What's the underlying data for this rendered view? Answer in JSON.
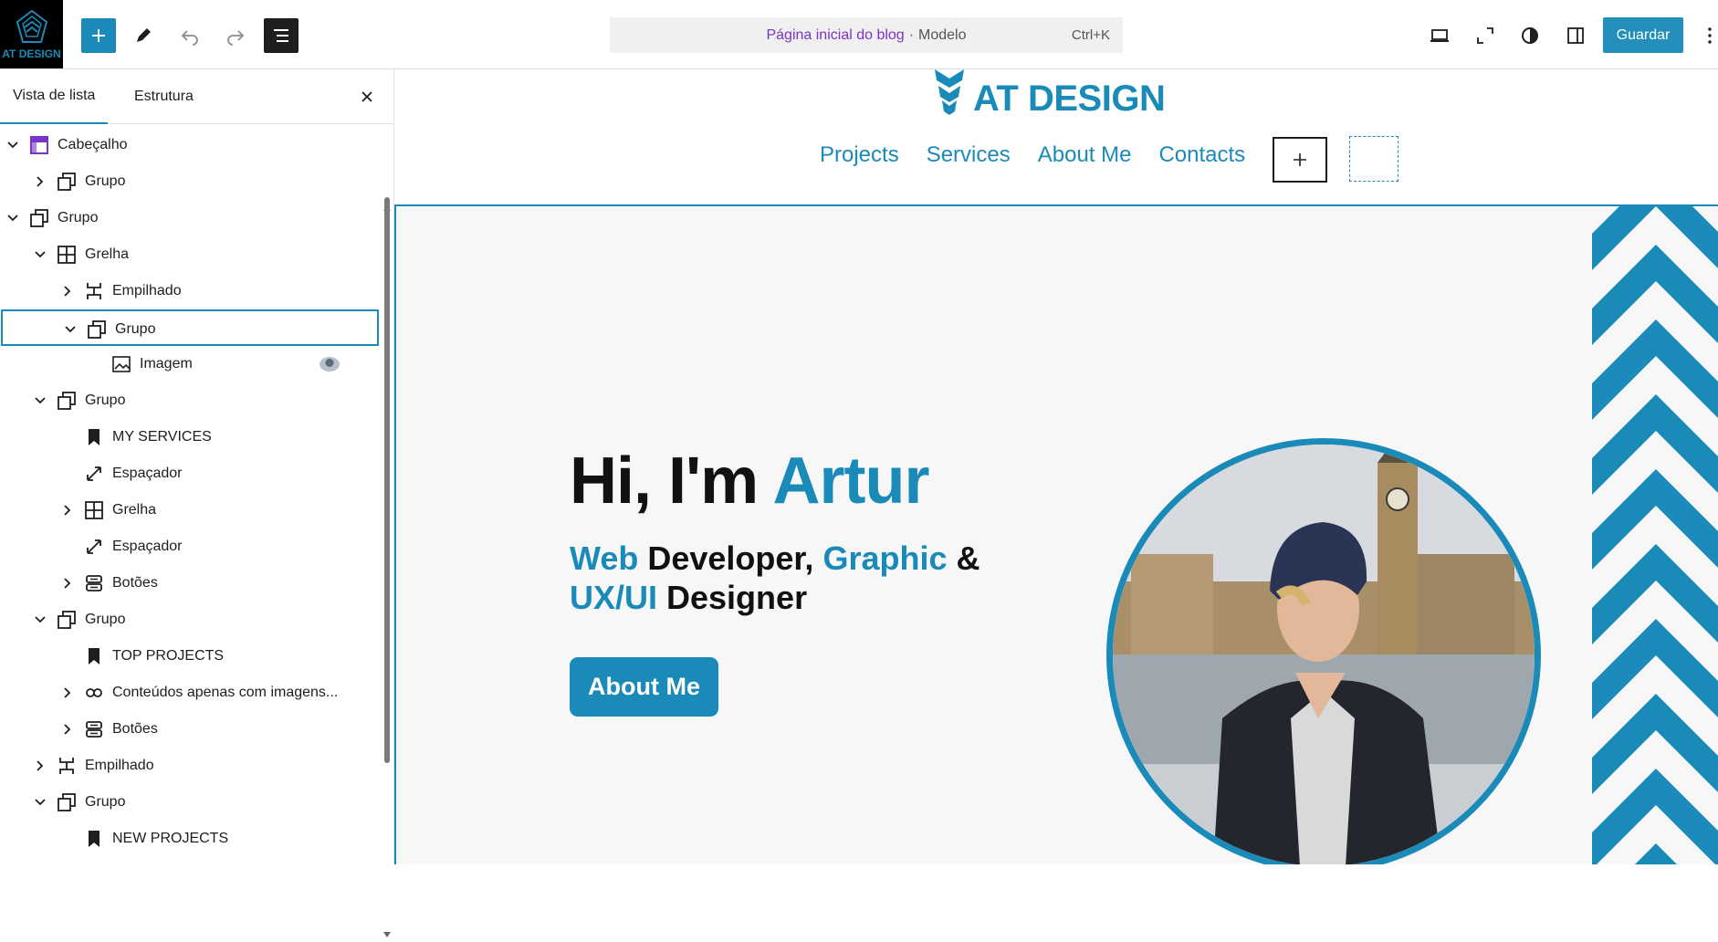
{
  "toolbar": {
    "logo_text": "AT DESIGN",
    "command": {
      "title": "Página inicial do blog",
      "separator": "·",
      "type": "Modelo",
      "shortcut": "Ctrl+K"
    },
    "save_label": "Guardar"
  },
  "sidebar": {
    "tabs": [
      {
        "label": "Vista de lista",
        "active": true
      },
      {
        "label": "Estrutura",
        "active": false
      }
    ],
    "tree": [
      {
        "label": "Cabeçalho",
        "depth": 0,
        "icon": "template-part-icon",
        "expanded": true
      },
      {
        "label": "Grupo",
        "depth": 1,
        "icon": "group-icon",
        "expanded": false
      },
      {
        "label": "Grupo",
        "depth": 0,
        "icon": "group-icon",
        "expanded": true
      },
      {
        "label": "Grelha",
        "depth": 1,
        "icon": "grid-icon",
        "expanded": true
      },
      {
        "label": "Empilhado",
        "depth": 2,
        "icon": "stack-icon",
        "expanded": false
      },
      {
        "label": "Grupo",
        "depth": 2,
        "icon": "group-icon",
        "expanded": true,
        "selected": true
      },
      {
        "label": "Imagem",
        "depth": 3,
        "icon": "image-icon",
        "leaf": true,
        "thumbnail": true
      },
      {
        "label": "Grupo",
        "depth": 1,
        "icon": "group-icon",
        "expanded": true
      },
      {
        "label": "MY SERVICES",
        "depth": 2,
        "icon": "heading-bookmark-icon",
        "leaf": true
      },
      {
        "label": "Espaçador",
        "depth": 2,
        "icon": "spacer-icon",
        "leaf": true
      },
      {
        "label": "Grelha",
        "depth": 2,
        "icon": "grid-icon",
        "expanded": false
      },
      {
        "label": "Espaçador",
        "depth": 2,
        "icon": "spacer-icon",
        "leaf": true
      },
      {
        "label": "Botões",
        "depth": 2,
        "icon": "buttons-icon",
        "expanded": false
      },
      {
        "label": "Grupo",
        "depth": 1,
        "icon": "group-icon",
        "expanded": true
      },
      {
        "label": "TOP PROJECTS",
        "depth": 2,
        "icon": "heading-bookmark-icon",
        "leaf": true
      },
      {
        "label": "Conteúdos apenas com imagens...",
        "depth": 2,
        "icon": "query-loop-icon",
        "expanded": false
      },
      {
        "label": "Botões",
        "depth": 2,
        "icon": "buttons-icon",
        "expanded": false
      },
      {
        "label": "Empilhado",
        "depth": 1,
        "icon": "stack-icon",
        "expanded": false
      },
      {
        "label": "Grupo",
        "depth": 1,
        "icon": "group-icon",
        "expanded": true
      },
      {
        "label": "NEW PROJECTS",
        "depth": 2,
        "icon": "heading-bookmark-icon",
        "leaf": true
      }
    ]
  },
  "site": {
    "brand": "AT DESIGN",
    "nav": [
      "Projects",
      "Services",
      "About Me",
      "Contacts"
    ],
    "hero": {
      "title_plain": "Hi, I'm",
      "title_accent": "Artur",
      "sub": [
        {
          "text": "Web",
          "accent": true
        },
        {
          "text": " Developer, ",
          "accent": false
        },
        {
          "text": "Graphic",
          "accent": true
        },
        {
          "text": " & ",
          "accent": false
        },
        {
          "text": "UX/UI",
          "accent": true
        },
        {
          "text": " Designer",
          "accent": false
        }
      ],
      "button": "About Me"
    }
  },
  "colors": {
    "accent": "#1a8ab8",
    "command_title": "#7b33c9",
    "hero_bg": "#f7f7f7"
  }
}
